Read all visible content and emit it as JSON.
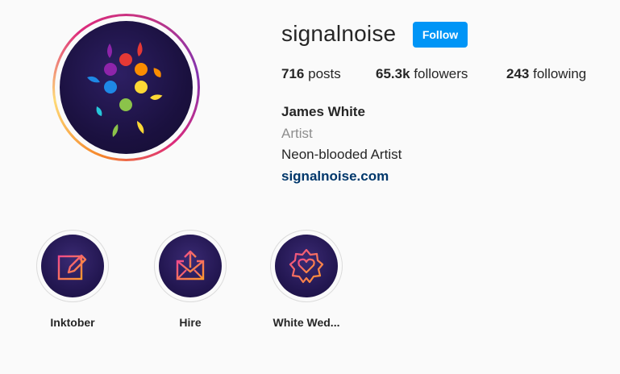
{
  "profile": {
    "username": "signalnoise",
    "follow_label": "Follow",
    "stats": {
      "posts_count": "716",
      "posts_label": "posts",
      "followers_count": "65.3k",
      "followers_label": "followers",
      "following_count": "243",
      "following_label": "following"
    },
    "bio": {
      "name": "James White",
      "category": "Artist",
      "description": "Neon-blooded Artist",
      "link": "signalnoise.com"
    }
  },
  "highlights": [
    {
      "label": "Inktober",
      "icon": "pencil-edit-icon"
    },
    {
      "label": "Hire",
      "icon": "envelope-upload-icon"
    },
    {
      "label": "White Wed...",
      "icon": "heart-badge-icon"
    }
  ],
  "colors": {
    "follow_button": "#0095f6",
    "link": "#00376b",
    "muted_text": "#8e8e8e",
    "icon_gradient_start": "#f04a8c",
    "icon_gradient_end": "#ff9a2e"
  }
}
